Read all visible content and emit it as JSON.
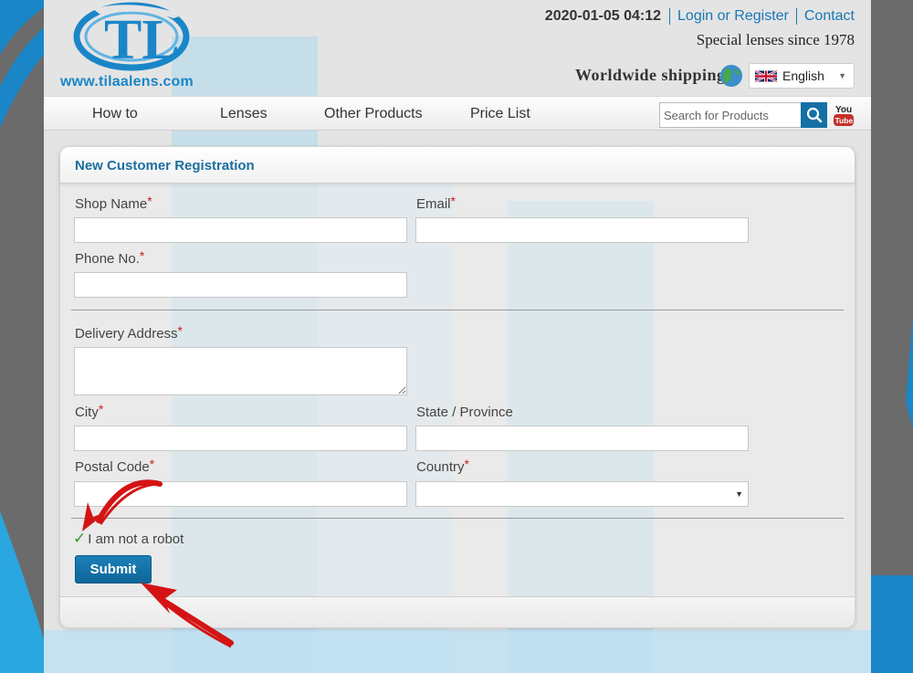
{
  "header": {
    "logo_letters": "TL",
    "logo_url": "www.tilaalens.com",
    "datetime": "2020-01-05 04:12",
    "links": [
      "Login or Register",
      "Contact"
    ],
    "tagline": "Special lenses since 1978",
    "shipping": "Worldwide shipping",
    "language": "English"
  },
  "nav": {
    "items": [
      "How to",
      "Lenses",
      "Other Products",
      "Price List"
    ],
    "search_placeholder": "Search for Products",
    "youtube_label": "YouTube"
  },
  "form": {
    "title": "New Customer Registration",
    "shop_name_label": "Shop Name",
    "email_label": "Email",
    "phone_label": "Phone No.",
    "delivery_label": "Delivery Address",
    "city_label": "City",
    "state_label": "State / Province",
    "postal_label": "Postal Code",
    "country_label": "Country",
    "required_mark": "*",
    "robot_check": "✓",
    "robot_label": "I am not a robot",
    "submit_label": "Submit"
  },
  "colors": {
    "accent": "#1570a6",
    "link": "#1878b4",
    "required": "#c91c1c",
    "check": "#2e9a2e",
    "annotation_arrow": "#d41414"
  }
}
